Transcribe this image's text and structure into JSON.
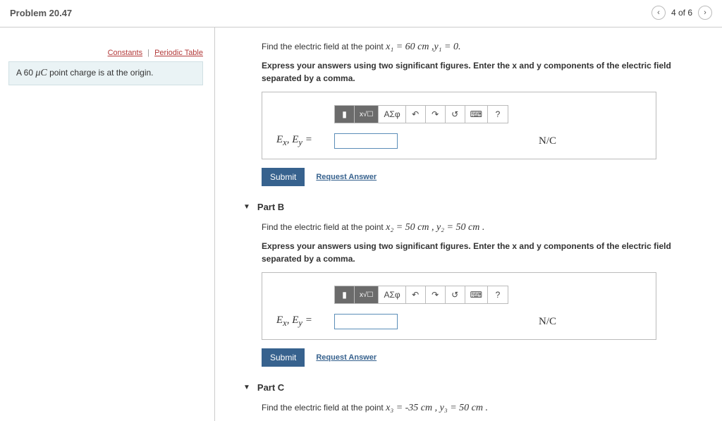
{
  "header": {
    "title": "Problem 20.47",
    "counter": "4 of 6"
  },
  "left": {
    "constants": "Constants",
    "periodic": "Periodic Table",
    "statement_pre": "A 60 ",
    "statement_mu": "μC",
    "statement_post": " point charge is at the origin."
  },
  "partA": {
    "line1_pre": "Find the electric field at the point ",
    "line1_x": "x₁ = 60 cm ,",
    "line1_y": "y₁ = 0.",
    "line2": "Express your answers using two significant figures. Enter the x and y components of the electric field separated by a comma.",
    "field_label": "Eₓ, E_y =",
    "unit": "N/C",
    "submit": "Submit",
    "request": "Request Answer",
    "tool_greek": "ΑΣφ",
    "tool_help": "?"
  },
  "partB": {
    "title": "Part B",
    "line1_pre": "Find the electric field at the point ",
    "line1_x": "x₂ = 50 cm , ",
    "line1_y": "y₂ = 50 cm .",
    "line2": "Express your answers using two significant figures. Enter the x and y components of the electric field separated by a comma.",
    "field_label": "Eₓ, E_y =",
    "unit": "N/C",
    "submit": "Submit",
    "request": "Request Answer",
    "tool_greek": "ΑΣφ",
    "tool_help": "?"
  },
  "partC": {
    "title": "Part C",
    "line1_pre": "Find the electric field at the point ",
    "line1_x": "x₃ = -35 cm , ",
    "line1_y": "y₃ = 50 cm ."
  }
}
